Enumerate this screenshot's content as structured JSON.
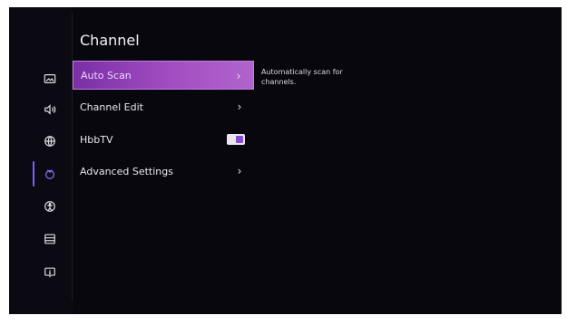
{
  "header": {
    "title": "Channel"
  },
  "menu": {
    "items": [
      {
        "label": "Auto Scan"
      },
      {
        "label": "Channel Edit"
      },
      {
        "label": "HbbTV",
        "toggle_on": true
      },
      {
        "label": "Advanced Settings"
      }
    ]
  },
  "description": {
    "text": "Automatically scan for channels."
  },
  "sidebar": {
    "icons": [
      {
        "name": "picture-icon"
      },
      {
        "name": "sound-icon"
      },
      {
        "name": "network-icon"
      },
      {
        "name": "channel-icon",
        "active": true
      },
      {
        "name": "accessibility-icon"
      },
      {
        "name": "system-icon"
      },
      {
        "name": "support-icon"
      }
    ]
  },
  "colors": {
    "focus_gradient_start": "#7a2fa6",
    "focus_gradient_end": "#b064cc",
    "active_indicator": "#7d5cff"
  }
}
